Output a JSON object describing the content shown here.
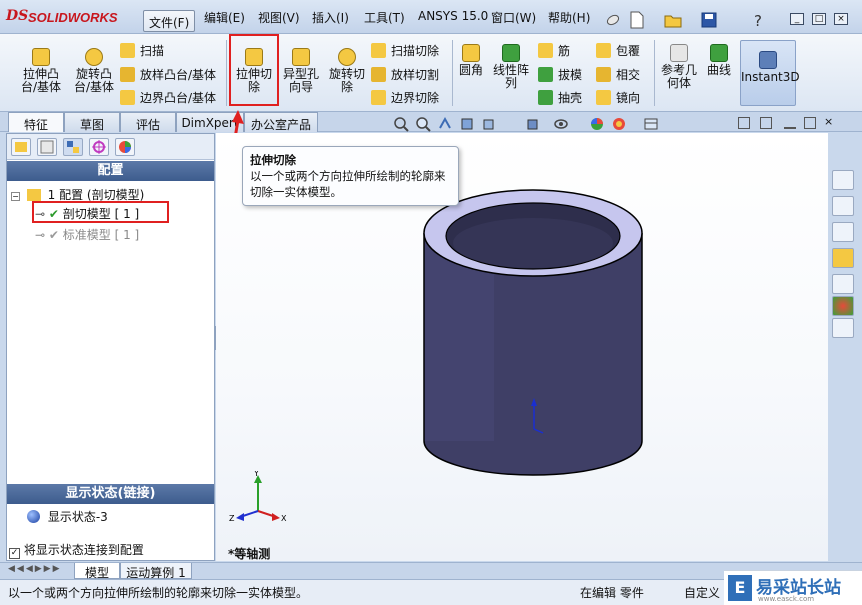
{
  "app": {
    "brand": "SOLIDWORKS",
    "brand_glyph": "DS"
  },
  "menubar": {
    "items": [
      "文件(F)",
      "编辑(E)",
      "视图(V)",
      "插入(I)",
      "工具(T)",
      "ANSYS 15.0",
      "窗口(W)",
      "帮助(H)"
    ]
  },
  "commands": {
    "extrude_boss": "拉伸凸\n台/基体",
    "revolve_boss": "旋转凸\n台/基体",
    "sweep": "扫描",
    "loft_boss": "放样凸台/基体",
    "boundary_boss": "边界凸台/基体",
    "extrude_cut": "拉伸切\n除",
    "hole_wizard": "异型孔\n向导",
    "revolve_cut": "旋转切\n除",
    "sweep_cut": "扫描切除",
    "loft_cut": "放样切割",
    "boundary_cut": "边界切除",
    "fillet": "圆角",
    "linear_pattern": "线性阵\n列",
    "rib": "筋",
    "draft": "拔模",
    "shell": "抽壳",
    "wrap": "包覆",
    "intersect": "相交",
    "mirror": "镜向",
    "reference_geometry": "参考几\n何体",
    "curves": "曲线",
    "instant3d": "Instant3D"
  },
  "tabs": [
    "特征",
    "草图",
    "评估",
    "DimXpert",
    "办公室产品"
  ],
  "tooltip": {
    "title": "拉伸切除",
    "body": "以一个或两个方向拉伸所绘制的轮廓来切除一实体模型。"
  },
  "config_panel": {
    "header": "配置",
    "root": "1 配置 (剖切模型)",
    "items": [
      {
        "label": "剖切模型 [ 1 ]",
        "active": true
      },
      {
        "label": "标准模型 [ 1 ]",
        "active": false
      }
    ]
  },
  "display_state_panel": {
    "header": "显示状态(链接)",
    "item": "显示状态-3",
    "checkbox_label": "将显示状态连接到配置",
    "checked": true
  },
  "viewport": {
    "view_label": "*等轴测",
    "axes": {
      "x": "X",
      "y": "Y",
      "z": "Z"
    }
  },
  "bottom_tabs": [
    "模型",
    "运动算例 1"
  ],
  "statusbar": {
    "message": "以一个或两个方向拉伸所绘制的轮廓来切除一实体模型。",
    "mode": "在编辑 零件",
    "custom": "自定义"
  },
  "watermark": {
    "text": "易采站长站",
    "sub": "www.easck.com"
  },
  "colors": {
    "highlight": "#e02020",
    "cylinder": "#3f3f66",
    "cylinder_top": "#c6c6ee"
  }
}
